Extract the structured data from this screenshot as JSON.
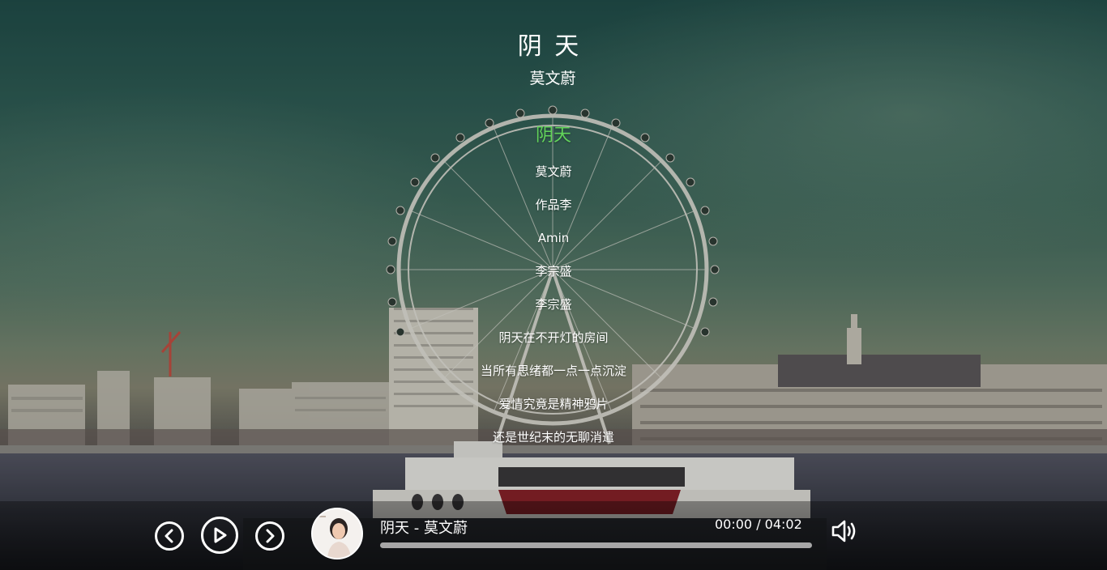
{
  "song": {
    "title": "阴 天",
    "artist": "莫文蔚"
  },
  "lyrics": {
    "active_index": 0,
    "lines": [
      "阴天",
      "莫文蔚",
      "作品李",
      "Amin",
      "李宗盛",
      "李宗盛",
      "阴天在不开灯的房间",
      "当所有思绪都一点一点沉淀",
      "爱情究竟是精神鸦片",
      "还是世纪末的无聊消遣"
    ],
    "active_color": "#63d45b"
  },
  "player": {
    "track_label": "阴天 - 莫文蔚",
    "time": "00:00 / 04:02",
    "progress": 0,
    "is_playing": false,
    "icons": {
      "prev": "chevron-left-icon",
      "play": "play-icon",
      "next": "chevron-right-icon",
      "volume": "volume-icon"
    }
  }
}
